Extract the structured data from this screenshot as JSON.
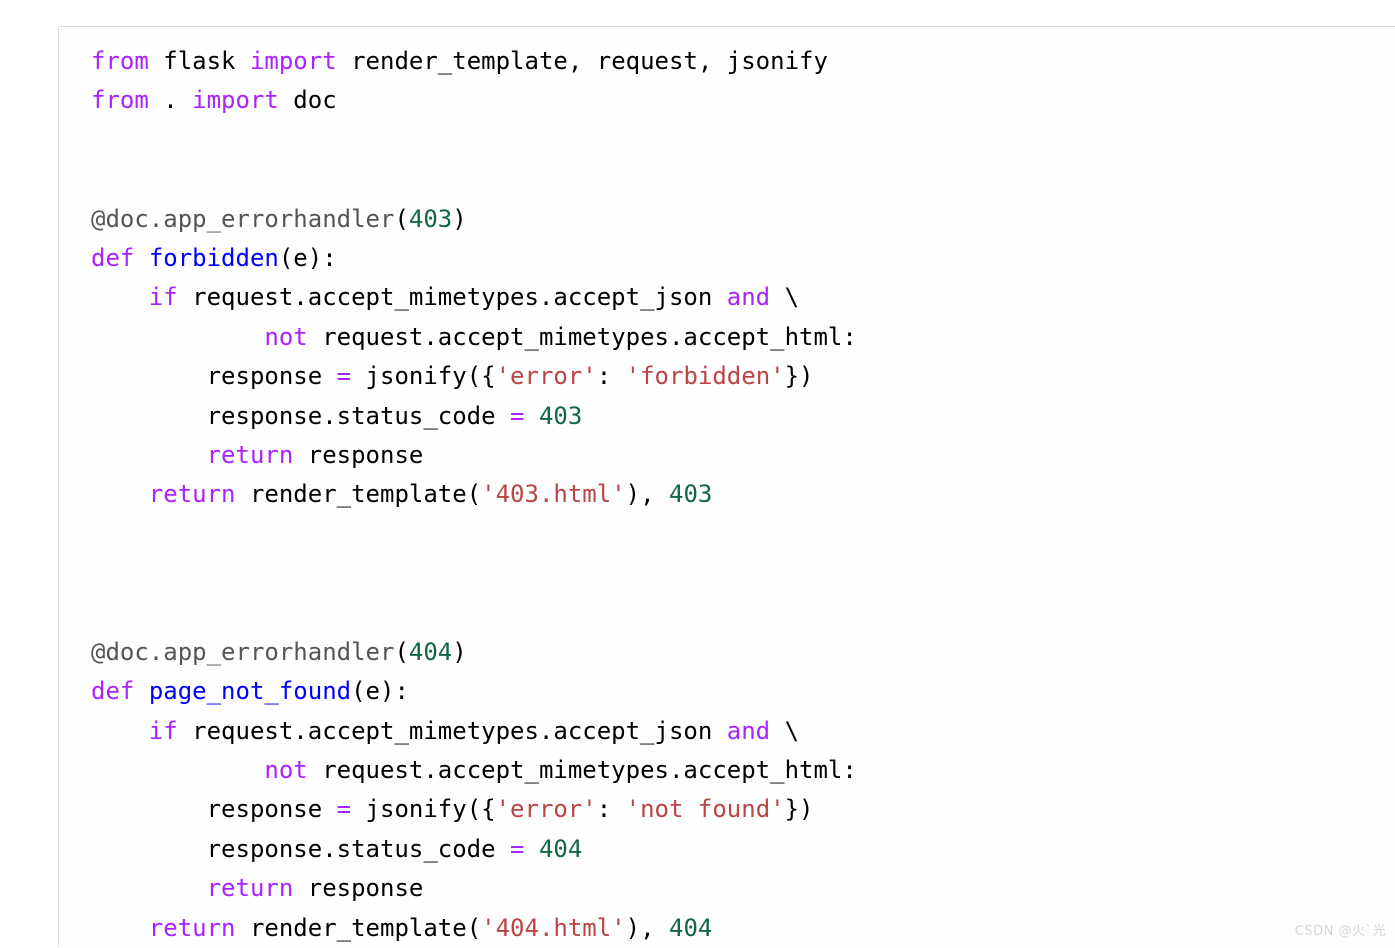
{
  "code_block": {
    "language": "python",
    "background_color": "#fefefe",
    "border_color": "#dcdcdc",
    "font_size_px": 24,
    "line_height_px": 39,
    "theme": {
      "keyword_color": "#aa22ff",
      "function_color": "#0000ff",
      "string_color": "#bb4444",
      "number_color": "#116644",
      "decorator_color": "#555555",
      "default_text_color": "#000000"
    },
    "plain_text": "from flask import render_template, request, jsonify\nfrom . import doc\n\n\n@doc.app_errorhandler(403)\ndef forbidden(e):\n    if request.accept_mimetypes.accept_json and \\\n            not request.accept_mimetypes.accept_html:\n        response = jsonify({'error': 'forbidden'})\n        response.status_code = 403\n        return response\n    return render_template('403.html'), 403\n\n\n\n@doc.app_errorhandler(404)\ndef page_not_found(e):\n    if request.accept_mimetypes.accept_json and \\\n            not request.accept_mimetypes.accept_html:\n        response = jsonify({'error': 'not found'})\n        response.status_code = 404\n        return response\n    return render_template('404.html'), 404",
    "lines": [
      {
        "id": "l1",
        "tokens": [
          {
            "t": "from",
            "c": "kw"
          },
          {
            "t": " ",
            "c": "name"
          },
          {
            "t": "flask",
            "c": "name"
          },
          {
            "t": " ",
            "c": "name"
          },
          {
            "t": "import",
            "c": "kw"
          },
          {
            "t": " render_template, request, jsonify",
            "c": "name"
          }
        ]
      },
      {
        "id": "l2",
        "tokens": [
          {
            "t": "from",
            "c": "kw"
          },
          {
            "t": " . ",
            "c": "name"
          },
          {
            "t": "import",
            "c": "kw"
          },
          {
            "t": " doc",
            "c": "name"
          }
        ]
      },
      {
        "id": "l3",
        "tokens": []
      },
      {
        "id": "l4",
        "tokens": []
      },
      {
        "id": "l5",
        "tokens": [
          {
            "t": "@doc.app_errorhandler",
            "c": "dec"
          },
          {
            "t": "(",
            "c": "name"
          },
          {
            "t": "403",
            "c": "num"
          },
          {
            "t": ")",
            "c": "name"
          }
        ]
      },
      {
        "id": "l6",
        "tokens": [
          {
            "t": "def",
            "c": "kw"
          },
          {
            "t": " ",
            "c": "name"
          },
          {
            "t": "forbidden",
            "c": "fn"
          },
          {
            "t": "(e):",
            "c": "name"
          }
        ]
      },
      {
        "id": "l7",
        "tokens": [
          {
            "t": "    ",
            "c": "name"
          },
          {
            "t": "if",
            "c": "kw"
          },
          {
            "t": " request.accept_mimetypes.accept_json ",
            "c": "name"
          },
          {
            "t": "and",
            "c": "kw"
          },
          {
            "t": " \\",
            "c": "name"
          }
        ]
      },
      {
        "id": "l8",
        "tokens": [
          {
            "t": "            ",
            "c": "name"
          },
          {
            "t": "not",
            "c": "kw"
          },
          {
            "t": " request.accept_mimetypes.accept_html:",
            "c": "name"
          }
        ]
      },
      {
        "id": "l9",
        "tokens": [
          {
            "t": "        response ",
            "c": "name"
          },
          {
            "t": "=",
            "c": "op"
          },
          {
            "t": " jsonify({",
            "c": "name"
          },
          {
            "t": "'error'",
            "c": "str"
          },
          {
            "t": ": ",
            "c": "name"
          },
          {
            "t": "'forbidden'",
            "c": "str"
          },
          {
            "t": "})",
            "c": "name"
          }
        ]
      },
      {
        "id": "l10",
        "tokens": [
          {
            "t": "        response.status_code ",
            "c": "name"
          },
          {
            "t": "=",
            "c": "op"
          },
          {
            "t": " ",
            "c": "name"
          },
          {
            "t": "403",
            "c": "num"
          }
        ]
      },
      {
        "id": "l11",
        "tokens": [
          {
            "t": "        ",
            "c": "name"
          },
          {
            "t": "return",
            "c": "kw"
          },
          {
            "t": " response",
            "c": "name"
          }
        ]
      },
      {
        "id": "l12",
        "tokens": [
          {
            "t": "    ",
            "c": "name"
          },
          {
            "t": "return",
            "c": "kw"
          },
          {
            "t": " render_template(",
            "c": "name"
          },
          {
            "t": "'403.html'",
            "c": "str"
          },
          {
            "t": "), ",
            "c": "name"
          },
          {
            "t": "403",
            "c": "num"
          }
        ]
      },
      {
        "id": "l13",
        "tokens": []
      },
      {
        "id": "l14",
        "tokens": []
      },
      {
        "id": "l15",
        "tokens": []
      },
      {
        "id": "l16",
        "tokens": [
          {
            "t": "@doc.app_errorhandler",
            "c": "dec"
          },
          {
            "t": "(",
            "c": "name"
          },
          {
            "t": "404",
            "c": "num"
          },
          {
            "t": ")",
            "c": "name"
          }
        ]
      },
      {
        "id": "l17",
        "tokens": [
          {
            "t": "def",
            "c": "kw"
          },
          {
            "t": " ",
            "c": "name"
          },
          {
            "t": "page_not_found",
            "c": "fn"
          },
          {
            "t": "(e):",
            "c": "name"
          }
        ]
      },
      {
        "id": "l18",
        "tokens": [
          {
            "t": "    ",
            "c": "name"
          },
          {
            "t": "if",
            "c": "kw"
          },
          {
            "t": " request.accept_mimetypes.accept_json ",
            "c": "name"
          },
          {
            "t": "and",
            "c": "kw"
          },
          {
            "t": " \\",
            "c": "name"
          }
        ]
      },
      {
        "id": "l19",
        "tokens": [
          {
            "t": "            ",
            "c": "name"
          },
          {
            "t": "not",
            "c": "kw"
          },
          {
            "t": " request.accept_mimetypes.accept_html:",
            "c": "name"
          }
        ]
      },
      {
        "id": "l20",
        "tokens": [
          {
            "t": "        response ",
            "c": "name"
          },
          {
            "t": "=",
            "c": "op"
          },
          {
            "t": " jsonify({",
            "c": "name"
          },
          {
            "t": "'error'",
            "c": "str"
          },
          {
            "t": ": ",
            "c": "name"
          },
          {
            "t": "'not found'",
            "c": "str"
          },
          {
            "t": "})",
            "c": "name"
          }
        ]
      },
      {
        "id": "l21",
        "tokens": [
          {
            "t": "        response.status_code ",
            "c": "name"
          },
          {
            "t": "=",
            "c": "op"
          },
          {
            "t": " ",
            "c": "name"
          },
          {
            "t": "404",
            "c": "num"
          }
        ]
      },
      {
        "id": "l22",
        "tokens": [
          {
            "t": "        ",
            "c": "name"
          },
          {
            "t": "return",
            "c": "kw"
          },
          {
            "t": " response",
            "c": "name"
          }
        ]
      },
      {
        "id": "l23",
        "tokens": [
          {
            "t": "    ",
            "c": "name"
          },
          {
            "t": "return",
            "c": "kw"
          },
          {
            "t": " render_template(",
            "c": "name"
          },
          {
            "t": "'404.html'",
            "c": "str"
          },
          {
            "t": "), ",
            "c": "name"
          },
          {
            "t": "404",
            "c": "num"
          }
        ]
      }
    ]
  },
  "watermark": {
    "text": "CSDN @火`光",
    "color": "#d6d6d6"
  }
}
